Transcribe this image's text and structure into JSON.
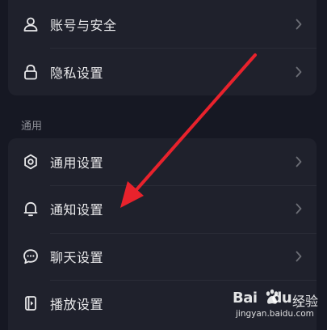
{
  "account_section": {
    "items": [
      {
        "label": "账号与安全",
        "icon": "user-icon"
      },
      {
        "label": "隐私设置",
        "icon": "lock-icon"
      }
    ]
  },
  "general_section": {
    "title": "通用",
    "items": [
      {
        "label": "通用设置",
        "icon": "gear-icon"
      },
      {
        "label": "通知设置",
        "icon": "bell-icon"
      },
      {
        "label": "聊天设置",
        "icon": "chat-bubble-icon"
      },
      {
        "label": "播放设置",
        "icon": "play-device-icon"
      }
    ]
  },
  "annotation": {
    "arrow_color": "#e8222c",
    "arrow_target": "通知设置"
  },
  "watermark": {
    "brand_left": "Bai",
    "brand_right": "du",
    "brand_suffix": "经验",
    "url": "jingyan.baidu.com"
  },
  "colors": {
    "background": "#161823",
    "card": "#1f212c",
    "text": "#e8e8ea",
    "secondary_text": "#8b8d95",
    "chevron": "#6c6e76"
  }
}
